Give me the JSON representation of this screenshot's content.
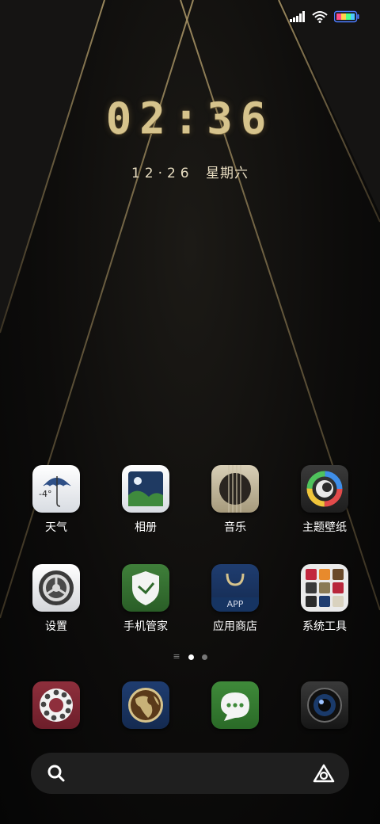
{
  "status": {
    "icons": [
      "signal-icon",
      "wifi-icon",
      "battery-icon"
    ]
  },
  "clock": {
    "time": "02:36"
  },
  "date": {
    "day": "12·26",
    "weekday": "星期六"
  },
  "apps_row1": [
    {
      "label": "天气",
      "icon": "weather-icon",
      "temp": "-4°"
    },
    {
      "label": "相册",
      "icon": "gallery-icon"
    },
    {
      "label": "音乐",
      "icon": "guitar-icon"
    },
    {
      "label": "主题壁纸",
      "icon": "theme-icon"
    }
  ],
  "apps_row2": [
    {
      "label": "设置",
      "icon": "gear-icon"
    },
    {
      "label": "手机管家",
      "icon": "shield-icon"
    },
    {
      "label": "应用商店",
      "icon": "shopping-bag-icon",
      "badge": "APP"
    },
    {
      "label": "系统工具",
      "icon": "folder-icon"
    }
  ],
  "dock": [
    {
      "icon": "rotary-phone-icon"
    },
    {
      "icon": "globe-icon"
    },
    {
      "icon": "message-icon"
    },
    {
      "icon": "camera-icon"
    }
  ],
  "page_indicator": {
    "pages": 3,
    "current": 2
  },
  "search": {
    "icons": [
      "search-icon",
      "assistant-icon"
    ]
  },
  "colors": {
    "gold": "#d6c38c",
    "accent_line": "#8a7a55"
  }
}
